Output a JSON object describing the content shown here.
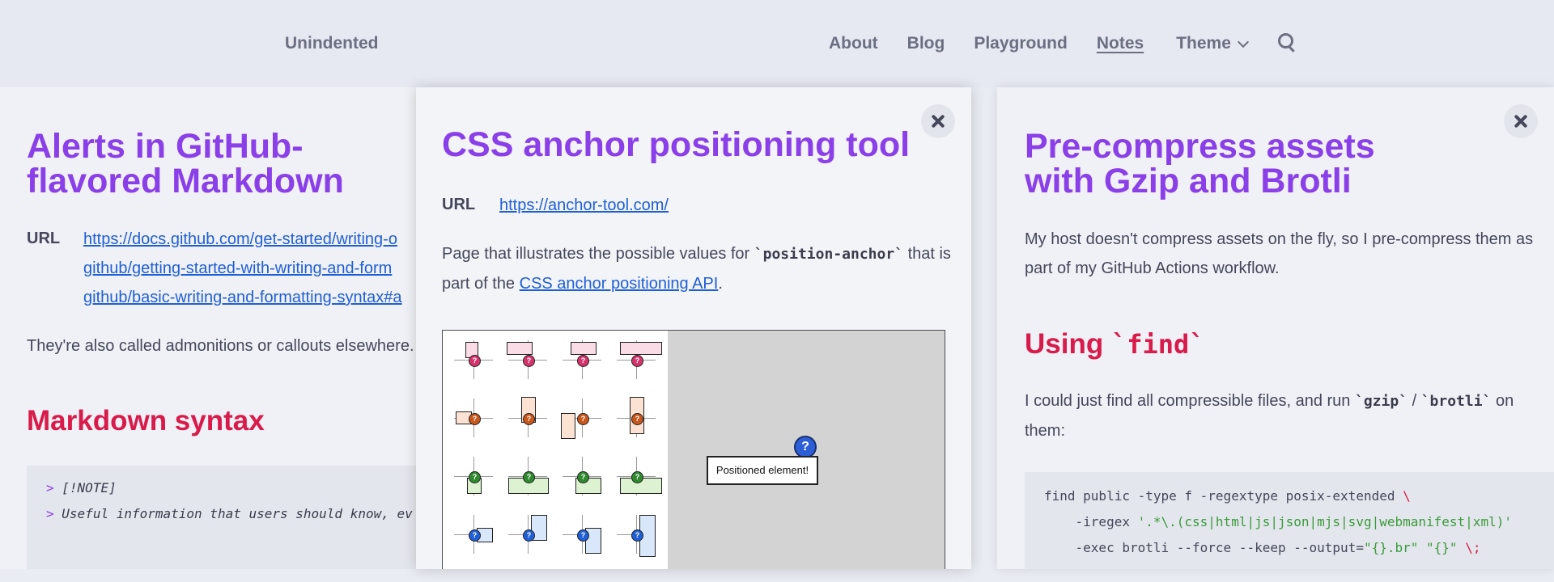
{
  "header": {
    "brand": "Unindented",
    "nav": [
      "About",
      "Blog",
      "Playground",
      "Notes"
    ],
    "theme_label": "Theme"
  },
  "card1": {
    "title_line1": "Alerts in GitHub-",
    "title_line2": "flavored Markdown",
    "url_label": "URL",
    "url_line1": "https://docs.github.com/get-started/writing-o",
    "url_line2": "github/getting-started-with-writing-and-form",
    "url_line3": "github/basic-writing-and-formatting-syntax#a",
    "intro": "They're also called admonitions or callouts elsewhere.",
    "heading": "Markdown syntax",
    "code_prefix": ">",
    "code_line1": "[!NOTE]",
    "code_line2": "Useful information that users should know, ev"
  },
  "card2": {
    "title": "CSS anchor positioning tool",
    "url_label": "URL",
    "url": "https://anchor-tool.com/",
    "desc_part1": "Page that illustrates the possible values for ",
    "desc_code": "`position-anchor`",
    "desc_part2": " that is",
    "desc_part3": "part of the ",
    "desc_link": "CSS anchor positioning API",
    "desc_part4": ".",
    "preview_label": "Positioned element!",
    "anchor_mark": "?"
  },
  "card3": {
    "title_line1": "Pre-compress assets",
    "title_line2": "with Gzip and Brotli",
    "intro_line1": "My host doesn't compress assets on the fly, so I pre-compress them as",
    "intro_line2": "part of my GitHub Actions workflow.",
    "heading_word": "Using ",
    "heading_code": "`find`",
    "p2_part1": "I could just find all compressible files, and run ",
    "p2_code1": "`gzip`",
    "p2_sep": " / ",
    "p2_code2": "`brotli`",
    "p2_part2": " on",
    "p2_line2": "them:",
    "code_line1": "find public -type f -regextype posix-extended ",
    "code_line1_end": "\\",
    "code_line2_pre": "    -iregex ",
    "code_line2_str": "'.*\\.(css|html|js|json|mjs|svg|webmanifest|xml)'",
    "code_line3_pre": "    -exec brotli --force --keep --output=",
    "code_line3_str1": "\"{}.br\"",
    "code_line3_str2": "\"{}\"",
    "code_line3_end": "\\;"
  },
  "colors": {
    "title": "#8a3fe8",
    "heading": "#d81b4a",
    "link": "#1f5fd6",
    "anchor": "#2c5fd6"
  }
}
